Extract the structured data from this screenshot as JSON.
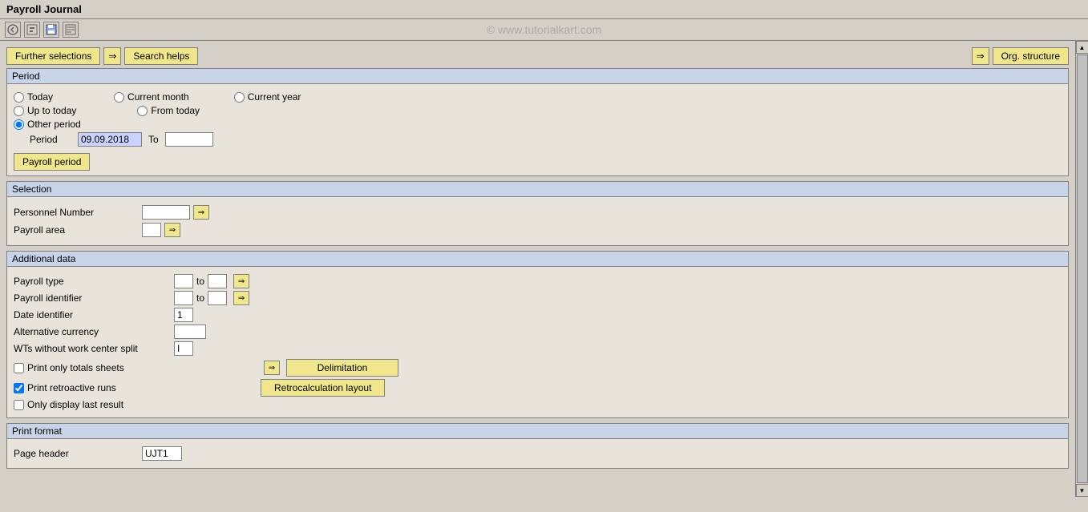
{
  "title": "Payroll Journal",
  "watermark": "© www.tutorialkart.com",
  "toolbar": {
    "icons": [
      "back",
      "forward",
      "save",
      "find"
    ]
  },
  "buttons": {
    "further_selections": "Further selections",
    "arrow1": "→",
    "search_helps": "Search helps",
    "arrow2": "→",
    "org_structure": "Org. structure"
  },
  "period": {
    "section_title": "Period",
    "radio_today": "Today",
    "radio_current_month": "Current month",
    "radio_current_year": "Current year",
    "radio_up_to_today": "Up to today",
    "radio_from_today": "From today",
    "radio_other_period": "Other period",
    "period_label": "Period",
    "period_value": "09.09.2018",
    "to_label": "To",
    "to_value": "",
    "payroll_period_btn": "Payroll period"
  },
  "selection": {
    "section_title": "Selection",
    "personnel_number_label": "Personnel Number",
    "personnel_number_value": "",
    "payroll_area_label": "Payroll area",
    "payroll_area_value": ""
  },
  "additional_data": {
    "section_title": "Additional data",
    "payroll_type_label": "Payroll type",
    "payroll_type_value": "",
    "payroll_type_to": "to",
    "payroll_type_to_value": "",
    "payroll_identifier_label": "Payroll identifier",
    "payroll_identifier_value": "",
    "payroll_identifier_to": "to",
    "payroll_identifier_to_value": "",
    "date_identifier_label": "Date identifier",
    "date_identifier_value": "1",
    "alternative_currency_label": "Alternative currency",
    "alternative_currency_value": "",
    "wts_label": "WTs without work center split",
    "wts_value": "I",
    "print_totals_label": "Print only totals sheets",
    "print_totals_checked": false,
    "delimitation_btn": "Delimitation",
    "print_retroactive_label": "Print retroactive runs",
    "print_retroactive_checked": true,
    "retrocalculation_btn": "Retrocalculation layout",
    "only_last_label": "Only display last result",
    "only_last_checked": false
  },
  "print_format": {
    "section_title": "Print format",
    "page_header_label": "Page header",
    "page_header_value": "UJT1"
  }
}
